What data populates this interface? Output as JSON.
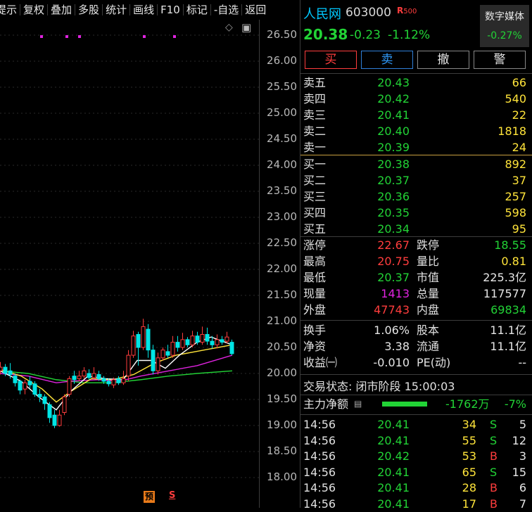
{
  "toolbar": {
    "items": [
      "提示",
      "复权",
      "叠加",
      "多股",
      "统计",
      "画线",
      "F10",
      "标记",
      "-自选",
      "返回"
    ]
  },
  "yaxis": {
    "ticks": [
      "26.50",
      "26.00",
      "25.50",
      "25.00",
      "24.50",
      "24.00",
      "23.50",
      "23.00",
      "22.50",
      "22.00",
      "21.50",
      "21.00",
      "20.50",
      "20.00",
      "19.50",
      "19.00",
      "18.50",
      "18.00"
    ]
  },
  "chart_icons": {
    "diamond": "◇",
    "panel": "▣",
    "yu_label": "预",
    "s_label": "S"
  },
  "stock": {
    "name": "人民网",
    "code": "603000",
    "tag": "R",
    "tag_num": "500",
    "sector": "数字媒体",
    "sector_change": "-0.27%",
    "price": "20.38",
    "change": "-0.23",
    "change_pct": "-1.12%"
  },
  "buttons": {
    "buy": "买",
    "sell": "卖",
    "cancel": "撤",
    "alert": "警"
  },
  "asks": [
    {
      "label": "卖五",
      "price": "20.43",
      "vol": "66"
    },
    {
      "label": "卖四",
      "price": "20.42",
      "vol": "540"
    },
    {
      "label": "卖三",
      "price": "20.41",
      "vol": "22"
    },
    {
      "label": "卖二",
      "price": "20.40",
      "vol": "1818"
    },
    {
      "label": "卖一",
      "price": "20.39",
      "vol": "24"
    }
  ],
  "bids": [
    {
      "label": "买一",
      "price": "20.38",
      "vol": "892"
    },
    {
      "label": "买二",
      "price": "20.37",
      "vol": "37"
    },
    {
      "label": "买三",
      "price": "20.36",
      "vol": "257"
    },
    {
      "label": "买四",
      "price": "20.35",
      "vol": "598"
    },
    {
      "label": "买五",
      "price": "20.34",
      "vol": "95"
    }
  ],
  "stats": {
    "limit_up_label": "涨停",
    "limit_up": "22.67",
    "limit_down_label": "跌停",
    "limit_down": "18.55",
    "high_label": "最高",
    "high": "20.75",
    "vol_ratio_label": "量比",
    "vol_ratio": "0.81",
    "low_label": "最低",
    "low": "20.37",
    "mcap_label": "市值",
    "mcap": "225.3亿",
    "cur_vol_label": "现量",
    "cur_vol": "1413",
    "total_vol_label": "总量",
    "total_vol": "117577",
    "outer_label": "外盘",
    "outer": "47743",
    "inner_label": "内盘",
    "inner": "69834",
    "turnover_label": "换手",
    "turnover": "1.06%",
    "shares_label": "股本",
    "shares": "11.1亿",
    "nav_label": "净资",
    "nav": "3.38",
    "float_label": "流通",
    "float": "11.1亿",
    "eps_label": "收益㈠",
    "eps": "-0.010",
    "pe_label": "PE(动)",
    "pe": "--"
  },
  "trade_status": "交易状态: 闭市阶段 15:00:03",
  "main_flow": {
    "label": "主力净额",
    "value": "-1762万",
    "pct": "-7%",
    "bar_color": "#22d336"
  },
  "ticks": [
    {
      "time": "14:56",
      "price": "20.41",
      "vol": "34",
      "bs": "S",
      "n": "5"
    },
    {
      "time": "14:56",
      "price": "20.41",
      "vol": "55",
      "bs": "S",
      "n": "12"
    },
    {
      "time": "14:56",
      "price": "20.42",
      "vol": "53",
      "bs": "B",
      "n": "3"
    },
    {
      "time": "14:56",
      "price": "20.41",
      "vol": "65",
      "bs": "S",
      "n": "15"
    },
    {
      "time": "14:56",
      "price": "20.41",
      "vol": "28",
      "bs": "B",
      "n": "6"
    },
    {
      "time": "14:56",
      "price": "20.41",
      "vol": "17",
      "bs": "B",
      "n": "7"
    }
  ],
  "colors": {
    "up": "#ff3d3d",
    "down": "#00e5e5",
    "ma5": "#ffffff",
    "ma10": "#ffe43a",
    "ma20": "#e023e0",
    "ma60": "#22d336",
    "marker": "#e023e0"
  }
}
